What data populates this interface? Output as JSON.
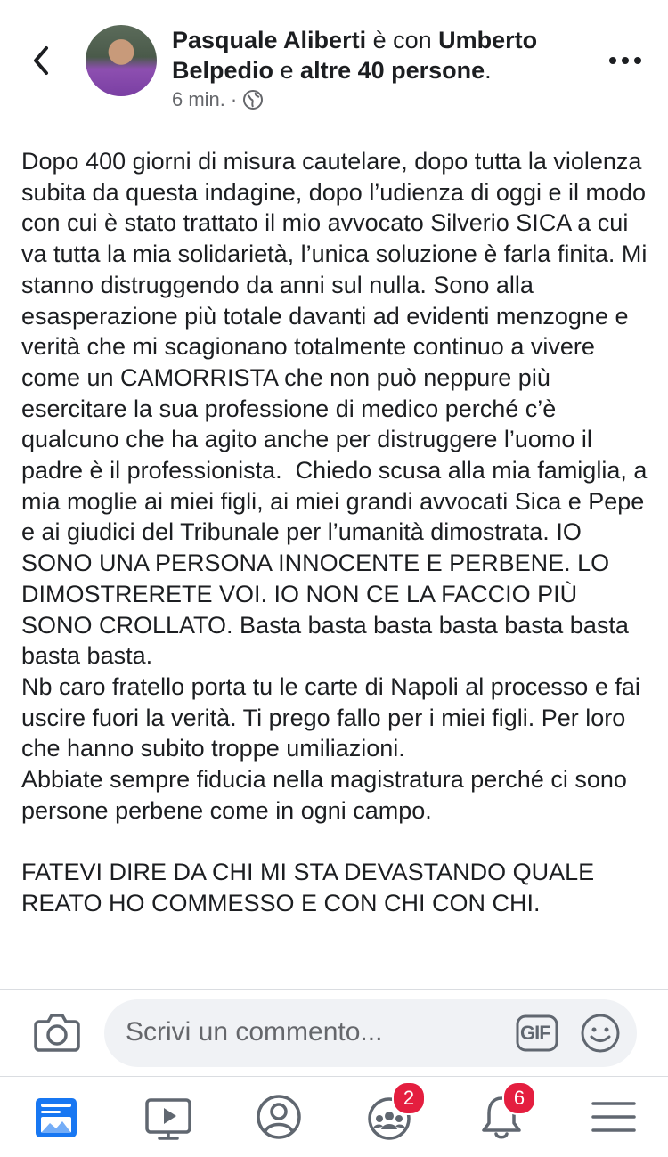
{
  "header": {
    "author_name": "Pasquale Aliberti",
    "with_word": " è con ",
    "tagged_person": "Umberto Belpedio",
    "and_word": " e ",
    "others": "altre 40 persone",
    "period": ".",
    "time": "6 min.",
    "dot": "·",
    "privacy_icon": "globe-icon",
    "back_icon": "chevron-left-icon",
    "more_icon": "more-horizontal-icon"
  },
  "post": {
    "text": "Dopo 400 giorni di misura cautelare, dopo tutta la violenza subita da questa indagine, dopo l’udienza di oggi e il modo con cui è stato trattato il mio avvocato Silverio SICA a cui va tutta la mia solidarietà, l’unica soluzione è farla finita. Mi stanno distruggendo da anni sul nulla. Sono alla esasperazione più totale davanti ad evidenti menzogne e verità che mi scagionano totalmente continuo a vivere come un CAMORRISTA che non può neppure più esercitare la sua professione di medico perché c’è qualcuno che ha agito anche per distruggere l’uomo il padre è il professionista.  Chiedo scusa alla mia famiglia, a mia moglie ai miei figli, ai miei grandi avvocati Sica e Pepe e ai giudici del Tribunale per l’umanità dimostrata. IO SONO UNA PERSONA INNOCENTE E PERBENE. LO DIMOSTRERETE VOI. IO NON CE LA FACCIO PIÙ SONO CROLLATO. Basta basta basta basta basta basta basta basta.\nNb caro fratello porta tu le carte di Napoli al processo e fai uscire fuori la verità. Ti prego fallo per i miei figli. Per loro che hanno subito troppe umiliazioni.\nAbbiate sempre fiducia nella magistratura perché ci sono persone perbene come in ogni campo.\n\nFATEVI DIRE DA CHI MI STA DEVASTANDO QUALE REATO HO COMMESSO E CON CHI CON CHI."
  },
  "comment_bar": {
    "placeholder": "Scrivi un commento...",
    "camera_icon": "camera-icon",
    "gif_label": "GIF",
    "emoji_icon": "smile-icon"
  },
  "nav": {
    "items": [
      {
        "name": "news-feed",
        "icon": "news-feed-icon",
        "active": true
      },
      {
        "name": "watch",
        "icon": "video-icon"
      },
      {
        "name": "profile",
        "icon": "profile-icon"
      },
      {
        "name": "groups",
        "icon": "groups-icon",
        "badge": "2"
      },
      {
        "name": "notifications",
        "icon": "bell-icon",
        "badge": "6"
      },
      {
        "name": "menu",
        "icon": "hamburger-icon"
      }
    ]
  },
  "colors": {
    "accent": "#1877f2",
    "badge": "#e41e3f",
    "text": "#1c1e21",
    "secondary_text": "#65676b",
    "icon_gray": "#606770"
  }
}
